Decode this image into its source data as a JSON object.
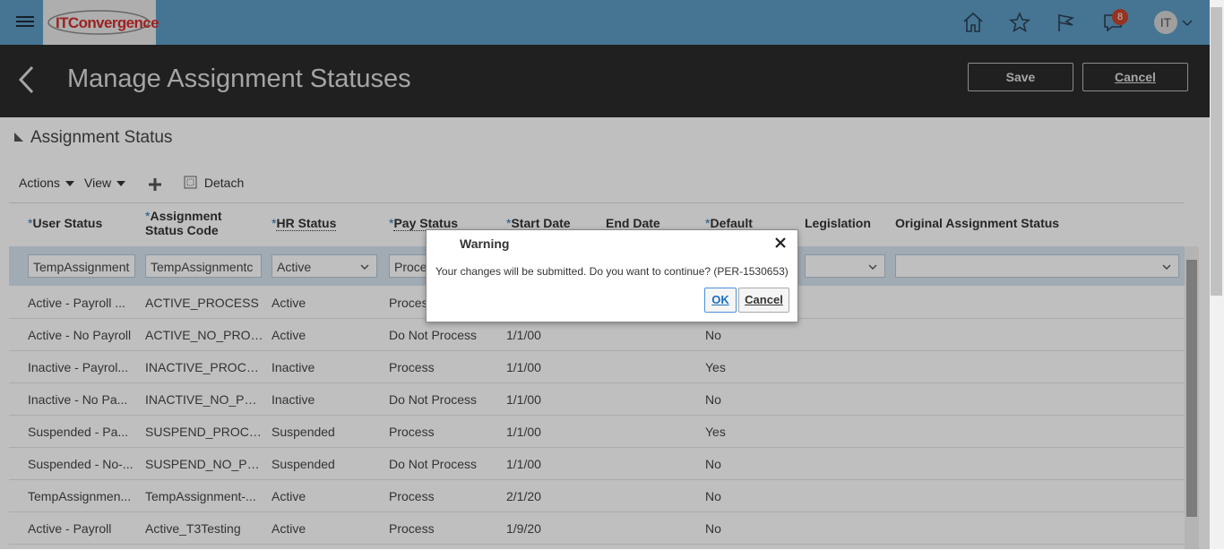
{
  "topbar": {
    "logo_text": "ITConvergence",
    "notification_count": "8",
    "avatar_initials": "IT",
    "icons": [
      "menu-icon",
      "home-icon",
      "favorites-star-icon",
      "watchlist-flag-icon",
      "notifications-bell-icon",
      "chevron-down-icon"
    ]
  },
  "header": {
    "title": "Manage Assignment Statuses",
    "save_label": "Save",
    "cancel_label": "Cancel"
  },
  "section": {
    "title": "Assignment Status"
  },
  "toolbar": {
    "actions_label": "Actions",
    "view_label": "View",
    "detach_label": "Detach"
  },
  "table": {
    "columns": [
      {
        "label": "User Status",
        "required": true
      },
      {
        "label1": "Assignment",
        "label2": "Status Code",
        "required": true
      },
      {
        "label": "HR Status",
        "required": true
      },
      {
        "label": "Pay Status",
        "required": true
      },
      {
        "label": "Start Date",
        "required": true
      },
      {
        "label": "End Date",
        "required": false
      },
      {
        "label": "Default",
        "required": true
      },
      {
        "label": "Legislation",
        "required": false
      },
      {
        "label": "Original Assignment Status",
        "required": false
      }
    ],
    "new_row": {
      "user_status": "TempAssignment",
      "status_code": "TempAssignmentc",
      "hr_status": "Active",
      "pay_status": "Proce"
    },
    "rows": [
      {
        "user_status": "Active - Payroll ...",
        "code": "ACTIVE_PROCESS",
        "hr": "Active",
        "pay": "Process",
        "start": "",
        "default": ""
      },
      {
        "user_status": "Active - No Payroll",
        "code": "ACTIVE_NO_PROC...",
        "hr": "Active",
        "pay": "Do Not Process",
        "start": "1/1/00",
        "default": "No"
      },
      {
        "user_status": "Inactive - Payrol...",
        "code": "INACTIVE_PROCESS",
        "hr": "Inactive",
        "pay": "Process",
        "start": "1/1/00",
        "default": "Yes"
      },
      {
        "user_status": "Inactive - No Pa...",
        "code": "INACTIVE_NO_PR...",
        "hr": "Inactive",
        "pay": "Do Not Process",
        "start": "1/1/00",
        "default": "No"
      },
      {
        "user_status": "Suspended - Pa...",
        "code": "SUSPEND_PROCESS",
        "hr": "Suspended",
        "pay": "Process",
        "start": "1/1/00",
        "default": "Yes"
      },
      {
        "user_status": "Suspended - No-...",
        "code": "SUSPEND_NO_PR...",
        "hr": "Suspended",
        "pay": "Do Not Process",
        "start": "1/1/00",
        "default": "No"
      },
      {
        "user_status": "TempAssignmen...",
        "code": "TempAssignment-...",
        "hr": "Active",
        "pay": "Process",
        "start": "2/1/20",
        "default": "No"
      },
      {
        "user_status": "Active - Payroll",
        "code": "Active_T3Testing",
        "hr": "Active",
        "pay": "Process",
        "start": "1/9/20",
        "default": "No"
      }
    ]
  },
  "dialog": {
    "title": "Warning",
    "message": "Your changes will be submitted. Do you want to continue? (PER-1530653)",
    "ok_label": "OK",
    "cancel_label": "Cancel"
  },
  "colors": {
    "topbar": "#5c9cc4",
    "titlebar": "#2b2b2b",
    "badge": "#c7452c",
    "filter_row": "#d6e4f0"
  }
}
